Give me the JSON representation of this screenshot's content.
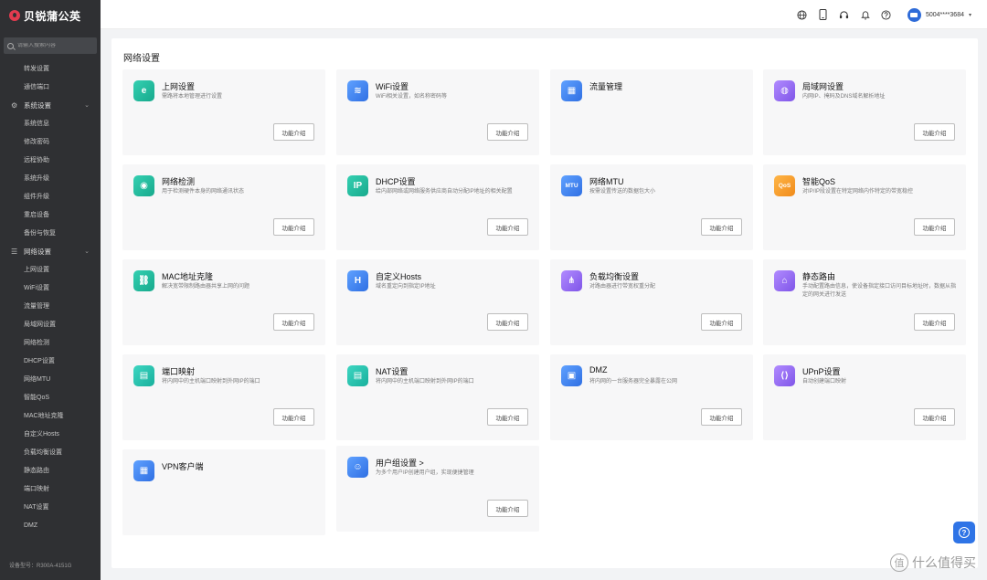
{
  "brand": {
    "name": "贝锐蒲公英"
  },
  "search": {
    "placeholder": "请输入搜索内容"
  },
  "sidebar": {
    "items": [
      {
        "label": "转发设置",
        "type": "item"
      },
      {
        "label": "通信端口",
        "type": "item"
      },
      {
        "label": "系统设置",
        "type": "group",
        "icon": "gear-icon"
      },
      {
        "label": "系统信息",
        "type": "item"
      },
      {
        "label": "修改密码",
        "type": "item"
      },
      {
        "label": "远程协助",
        "type": "item"
      },
      {
        "label": "系统升级",
        "type": "item"
      },
      {
        "label": "组件升级",
        "type": "item"
      },
      {
        "label": "重启设备",
        "type": "item"
      },
      {
        "label": "备份与恢复",
        "type": "item"
      },
      {
        "label": "网络设置",
        "type": "group",
        "icon": "sliders-icon"
      },
      {
        "label": "上网设置",
        "type": "item"
      },
      {
        "label": "WiFi设置",
        "type": "item"
      },
      {
        "label": "流量管理",
        "type": "item"
      },
      {
        "label": "局域网设置",
        "type": "item"
      },
      {
        "label": "网络检测",
        "type": "item"
      },
      {
        "label": "DHCP设置",
        "type": "item"
      },
      {
        "label": "网络MTU",
        "type": "item"
      },
      {
        "label": "智能QoS",
        "type": "item"
      },
      {
        "label": "MAC地址克隆",
        "type": "item"
      },
      {
        "label": "自定义Hosts",
        "type": "item"
      },
      {
        "label": "负载均衡设置",
        "type": "item"
      },
      {
        "label": "静态路由",
        "type": "item"
      },
      {
        "label": "端口映射",
        "type": "item"
      },
      {
        "label": "NAT设置",
        "type": "item"
      },
      {
        "label": "DMZ",
        "type": "item"
      }
    ],
    "device": "设备型号：R300A-4151G"
  },
  "topbar": {
    "icons": [
      "globe-icon",
      "phone-icon",
      "headset-icon",
      "bell-icon",
      "help-icon"
    ],
    "account": "5004****3684"
  },
  "main": {
    "title": "网络设置",
    "button_label": "功能介绍",
    "cards": [
      {
        "name": "上网设置",
        "desc": "需路将本地管理进行设置",
        "icon": "e-icon",
        "glyph": "e",
        "color": "g-green",
        "button": true
      },
      {
        "name": "WiFi设置",
        "desc": "WiFi相关设置，如名称密码等",
        "icon": "wifi-icon",
        "glyph": "≋",
        "color": "g-blue",
        "button": true
      },
      {
        "name": "流量管理",
        "desc": "",
        "icon": "grid-icon",
        "glyph": "▦",
        "color": "g-blue",
        "button": false
      },
      {
        "name": "局域网设置",
        "desc": "内网IP、掩码及DNS域名解析地址",
        "icon": "globe-icon",
        "glyph": "◍",
        "color": "g-purple",
        "button": true
      },
      {
        "name": "网络检测",
        "desc": "用于检测硬件本身的网络通讯状态",
        "icon": "chat-check-icon",
        "glyph": "◉",
        "color": "g-green",
        "button": true
      },
      {
        "name": "DHCP设置",
        "desc": "给内部网络或网络服务供应商自动分配IP地址的相关配置",
        "icon": "ip-icon",
        "glyph": "IP",
        "color": "g-green",
        "button": true
      },
      {
        "name": "网络MTU",
        "desc": "按需设置传送的数据包大小",
        "icon": "mtu-icon",
        "glyph": "MTU",
        "color": "g-blue",
        "button": true
      },
      {
        "name": "智能QoS",
        "desc": "对IP/IP段设置在特定网络内作特定的带宽稳控",
        "icon": "qos-icon",
        "glyph": "QoS",
        "color": "g-orange",
        "button": true
      },
      {
        "name": "MAC地址克隆",
        "desc": "解决宽带限制路由器共享上网的问题",
        "icon": "link-icon",
        "glyph": "⛓",
        "color": "g-green",
        "button": true
      },
      {
        "name": "自定义Hosts",
        "desc": "域名重定向到指定IP地址",
        "icon": "h-icon",
        "glyph": "H",
        "color": "g-blue",
        "button": true
      },
      {
        "name": "负载均衡设置",
        "desc": "对路由器进行带宽权重分配",
        "icon": "nodes-icon",
        "glyph": "⋔",
        "color": "g-purple",
        "button": true
      },
      {
        "name": "静态路由",
        "desc": "手动配置路由信息，使设备指定接口访问目标地址时，数据从指定的网关进行发送",
        "icon": "router-icon",
        "glyph": "⌂",
        "color": "g-purple",
        "button": true
      },
      {
        "name": "端口映射",
        "desc": "将内网中的主机端口映射到外网IP的端口",
        "icon": "port-icon",
        "glyph": "▤",
        "color": "g-teal",
        "button": true
      },
      {
        "name": "NAT设置",
        "desc": "将内网中的主机端口映射到外网IP的端口",
        "icon": "nat-icon",
        "glyph": "▤",
        "color": "g-teal",
        "button": true
      },
      {
        "name": "DMZ",
        "desc": "将内网的一台服务器完全暴露在公网",
        "icon": "dmz-icon",
        "glyph": "▣",
        "color": "g-blue",
        "button": true
      },
      {
        "name": "UPnP设置",
        "desc": "自动创建端口映射",
        "icon": "upnp-icon",
        "glyph": "⟨⟩",
        "color": "g-purple",
        "button": true
      },
      {
        "name": "VPN客户端",
        "desc": "",
        "icon": "vpn-icon",
        "glyph": "▦",
        "color": "g-blue",
        "button": false
      },
      {
        "name": "用户组设置 >",
        "desc": "为多个用户IP创建用户组，实现便捷管理",
        "icon": "users-icon",
        "glyph": "☺",
        "color": "g-blue",
        "button": true
      }
    ]
  },
  "watermark": "什么值得买"
}
